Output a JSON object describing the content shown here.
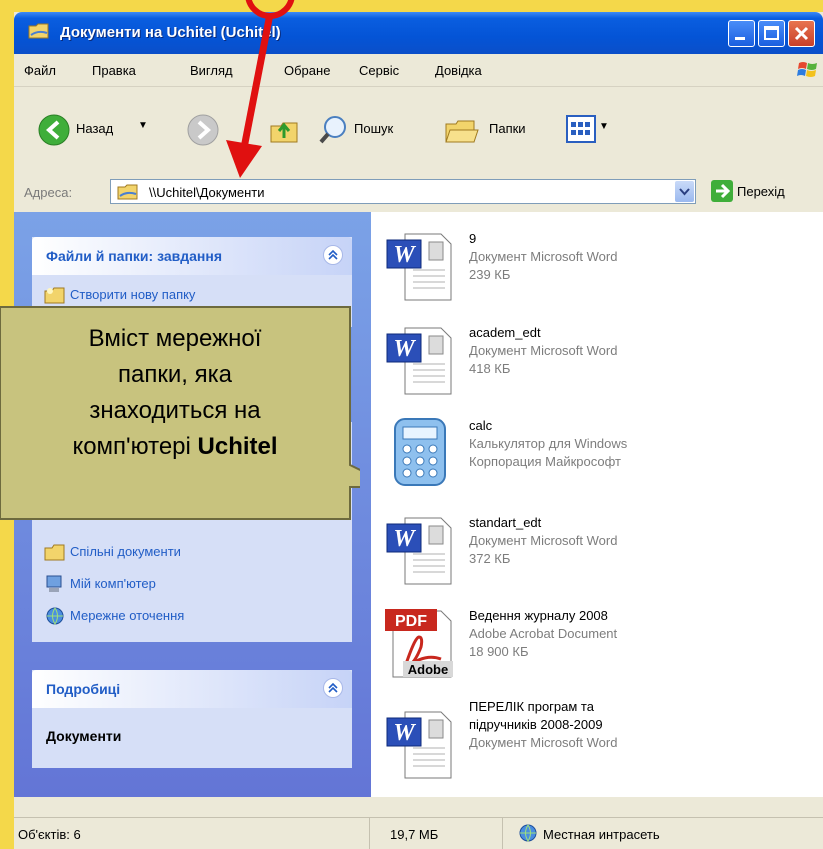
{
  "window": {
    "title": "Документи на Uchitel (Uchitel)"
  },
  "menu": {
    "items": [
      "Файл",
      "Правка",
      "Вигляд",
      "Обране",
      "Сервіс",
      "Довідка"
    ]
  },
  "toolbar": {
    "back_label": "Назад",
    "search_label": "Пошук",
    "folders_label": "Папки"
  },
  "address": {
    "label": "Адреса:",
    "value": "\\\\Uchitel\\Документи",
    "go_label": "Перехід"
  },
  "tasks_panel": {
    "title": "Файли й папки: завдання",
    "items": [
      {
        "label": "Створити нову папку",
        "icon": "new-folder-icon"
      }
    ]
  },
  "places_panel": {
    "items": [
      {
        "label": "Спільні документи",
        "icon": "folder-icon"
      },
      {
        "label": "Мій комп'ютер",
        "icon": "computer-icon"
      },
      {
        "label": "Мережне оточення",
        "icon": "network-icon"
      }
    ]
  },
  "details_panel": {
    "title": "Подробиці",
    "name": "Документи"
  },
  "files": [
    {
      "name": "9",
      "type": "Документ Microsoft Word",
      "info": "239 КБ",
      "icon": "word-doc-icon"
    },
    {
      "name": "academ_edt",
      "type": "Документ Microsoft Word",
      "info": "418 КБ",
      "icon": "word-doc-icon"
    },
    {
      "name": "calc",
      "type": "Калькулятор для Windows",
      "info": "Корпорация Майкрософт",
      "icon": "calculator-icon"
    },
    {
      "name": "standart_edt",
      "type": "Документ Microsoft Word",
      "info": "372 КБ",
      "icon": "word-doc-icon"
    },
    {
      "name": "Ведення журналу 2008",
      "type": "Adobe Acrobat Document",
      "info": "18 900 КБ",
      "icon": "pdf-icon"
    },
    {
      "name_line1": "ПЕРЕЛІК програм та",
      "name_line2": "підручників 2008-2009",
      "type": "Документ Microsoft Word",
      "icon": "word-doc-icon"
    }
  ],
  "status": {
    "objects": "Об'єктів: 6",
    "size": "19,7 МБ",
    "zone": "Местная интрасеть"
  },
  "callout": {
    "line1": "Вміст мережної",
    "line2": "папки, яка",
    "line3": "знаходиться на",
    "line4_prefix": "комп'ютері ",
    "line4_bold": "Uchitel"
  },
  "colors": {
    "title_blue": "#0454d6",
    "link_blue": "#215dc6",
    "callout_bg": "#c8c37e",
    "arrow_red": "#e01010"
  }
}
